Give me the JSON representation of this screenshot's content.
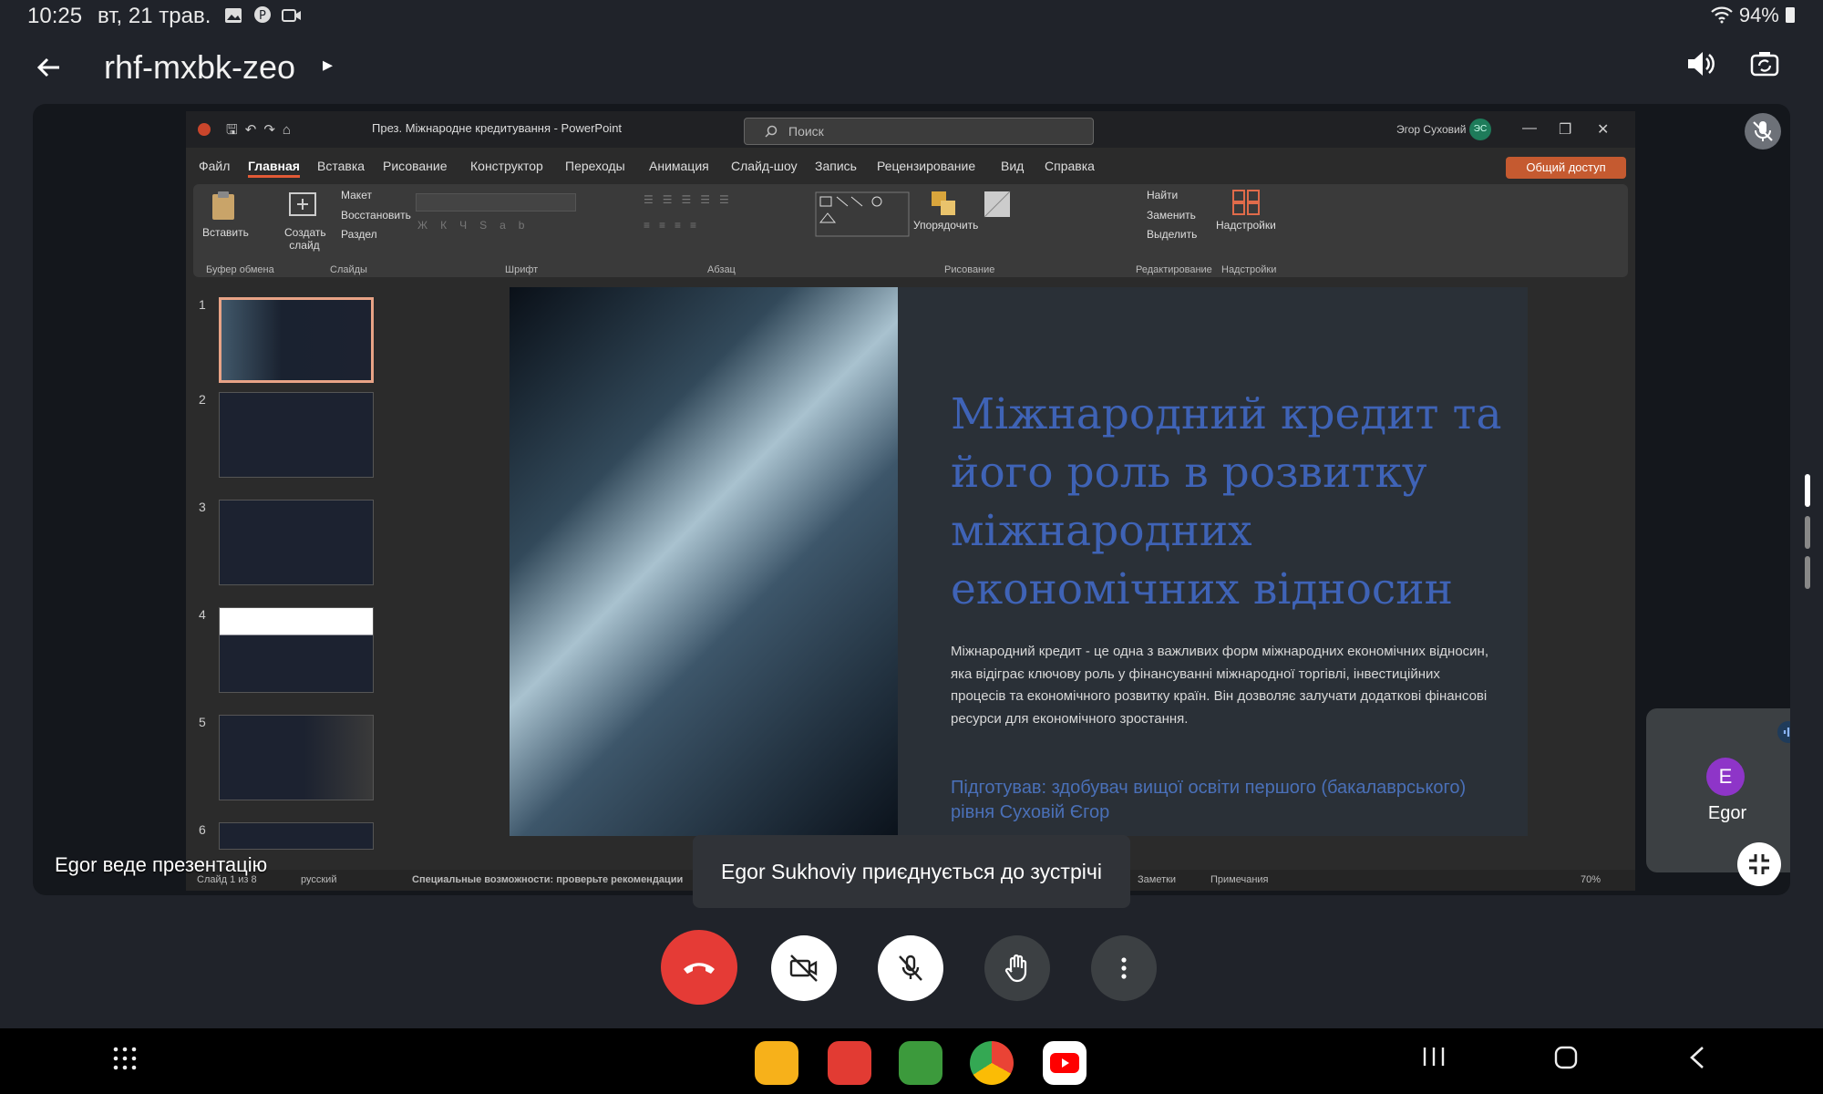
{
  "status_bar": {
    "time": "10:25",
    "date": "вт, 21 трав.",
    "battery": "94%",
    "icons": [
      "gallery-icon",
      "pinterest-icon",
      "video-icon",
      "wifi-icon",
      "battery-icon"
    ]
  },
  "app_bar": {
    "meeting_code": "rhf-mxbk-zeo"
  },
  "powerpoint": {
    "doc_title": "През. Міжнародне кредитування  -  PowerPoint",
    "search_placeholder": "Поиск",
    "user_name": "Эгор Суховий",
    "user_initials": "ЭС",
    "tabs": [
      "Файл",
      "Главная",
      "Вставка",
      "Рисование",
      "Конструктор",
      "Переходы",
      "Анимация",
      "Слайд-шоу",
      "Запись",
      "Рецензирование",
      "Вид",
      "Справка"
    ],
    "active_tab": "Главная",
    "share_button": "Общий доступ",
    "ribbon": {
      "paste": "Вставить",
      "new_slide": "Создать слайд",
      "layout": "Макет",
      "reset": "Восстановить",
      "section": "Раздел",
      "arrange": "Упорядочить",
      "find": "Найти",
      "replace": "Заменить",
      "select": "Выделить",
      "addins": "Надстройки",
      "groups": [
        "Буфер обмена",
        "Слайды",
        "Шрифт",
        "Абзац",
        "Рисование",
        "Редактирование",
        "Надстройки"
      ]
    },
    "thumbnail_numbers": [
      "1",
      "2",
      "3",
      "4",
      "5",
      "6"
    ],
    "slide": {
      "title": "Міжнародний кредит та його роль в розвитку міжнародних економічних відносин",
      "body": "Міжнародний кредит - це одна з важливих форм міжнародних економічних відносин, яка відіграє ключову роль у фінансуванні міжнародної торгівлі, інвестиційних процесів та економічного розвитку країн. Він дозволяє залучати додаткові фінансові ресурси для економічного зростання.",
      "author": "Підготував: здобувач вищої освіти першого (бакалаврського) рівня Суховій Єгор"
    },
    "status": {
      "slide_counter": "Слайд 1 из 8",
      "language": "русский",
      "accessibility": "Специальные возможности: проверьте рекомендации",
      "notes": "Заметки",
      "comments": "Примечания",
      "zoom": "70%"
    }
  },
  "presenter_label": "Egor веде презентацію",
  "self_tile": {
    "initial": "E",
    "name": "Egor"
  },
  "toast": "Egor Sukhoviy приєднується до зустрічі",
  "colors": {
    "end_call": "#e53b36",
    "avatar": "#8e35c8",
    "slide_title": "#3f63b6",
    "ppt_accent": "#c55a30"
  }
}
